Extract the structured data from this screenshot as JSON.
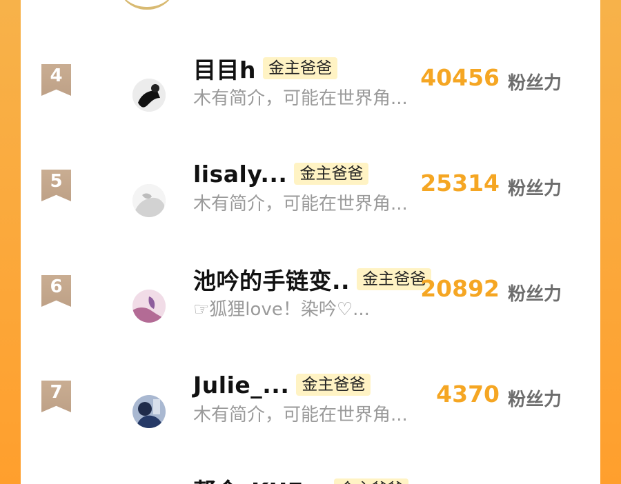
{
  "leaderboard": {
    "unit_label": "粉丝力",
    "rows": [
      {
        "rank": "4",
        "name": "目目h",
        "badge": "金主爸爸",
        "description": "木有简介，可能在世界角...",
        "score": "40456"
      },
      {
        "rank": "5",
        "name": "lisaly...",
        "badge": "金主爸爸",
        "description": "木有简介，可能在世界角...",
        "score": "25314"
      },
      {
        "rank": "6",
        "name": "池吟的手链变..",
        "badge": "金主爸爸",
        "description": "☞狐狸love！染吟♡...",
        "score": "20892"
      },
      {
        "rank": "7",
        "name": "Julie_...",
        "badge": "金主爸爸",
        "description": "木有简介，可能在世界角...",
        "score": "4370"
      }
    ],
    "partial_next": {
      "name": "帮金_KUF...",
      "badge": "金主爸爸"
    }
  },
  "colors": {
    "accent_orange": "#f5a623",
    "rank_tag": "#c3a78e",
    "badge_bg": "#fff3c4",
    "text_dark": "#111111",
    "text_muted": "#9a9a9a"
  },
  "icons": {
    "rank_icon": "ribbon-tag-icon",
    "avatar": "circular-user-avatar"
  }
}
